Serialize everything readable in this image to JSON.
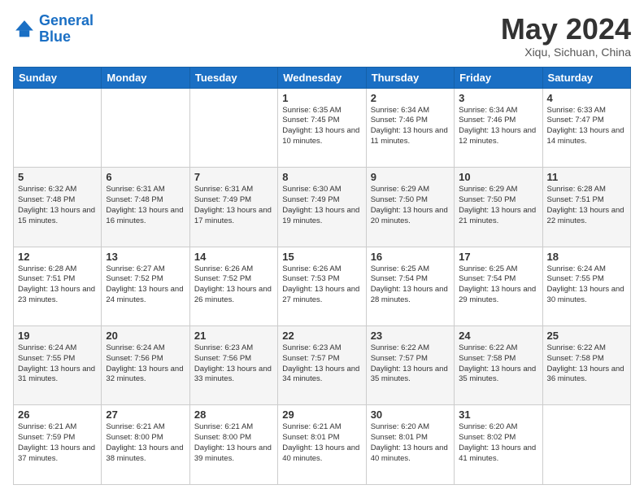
{
  "header": {
    "logo_line1": "General",
    "logo_line2": "Blue",
    "month_title": "May 2024",
    "location": "Xiqu, Sichuan, China"
  },
  "weekdays": [
    "Sunday",
    "Monday",
    "Tuesday",
    "Wednesday",
    "Thursday",
    "Friday",
    "Saturday"
  ],
  "weeks": [
    [
      {
        "day": "",
        "info": ""
      },
      {
        "day": "",
        "info": ""
      },
      {
        "day": "",
        "info": ""
      },
      {
        "day": "1",
        "info": "Sunrise: 6:35 AM\nSunset: 7:45 PM\nDaylight: 13 hours\nand 10 minutes."
      },
      {
        "day": "2",
        "info": "Sunrise: 6:34 AM\nSunset: 7:46 PM\nDaylight: 13 hours\nand 11 minutes."
      },
      {
        "day": "3",
        "info": "Sunrise: 6:34 AM\nSunset: 7:46 PM\nDaylight: 13 hours\nand 12 minutes."
      },
      {
        "day": "4",
        "info": "Sunrise: 6:33 AM\nSunset: 7:47 PM\nDaylight: 13 hours\nand 14 minutes."
      }
    ],
    [
      {
        "day": "5",
        "info": "Sunrise: 6:32 AM\nSunset: 7:48 PM\nDaylight: 13 hours\nand 15 minutes."
      },
      {
        "day": "6",
        "info": "Sunrise: 6:31 AM\nSunset: 7:48 PM\nDaylight: 13 hours\nand 16 minutes."
      },
      {
        "day": "7",
        "info": "Sunrise: 6:31 AM\nSunset: 7:49 PM\nDaylight: 13 hours\nand 17 minutes."
      },
      {
        "day": "8",
        "info": "Sunrise: 6:30 AM\nSunset: 7:49 PM\nDaylight: 13 hours\nand 19 minutes."
      },
      {
        "day": "9",
        "info": "Sunrise: 6:29 AM\nSunset: 7:50 PM\nDaylight: 13 hours\nand 20 minutes."
      },
      {
        "day": "10",
        "info": "Sunrise: 6:29 AM\nSunset: 7:50 PM\nDaylight: 13 hours\nand 21 minutes."
      },
      {
        "day": "11",
        "info": "Sunrise: 6:28 AM\nSunset: 7:51 PM\nDaylight: 13 hours\nand 22 minutes."
      }
    ],
    [
      {
        "day": "12",
        "info": "Sunrise: 6:28 AM\nSunset: 7:51 PM\nDaylight: 13 hours\nand 23 minutes."
      },
      {
        "day": "13",
        "info": "Sunrise: 6:27 AM\nSunset: 7:52 PM\nDaylight: 13 hours\nand 24 minutes."
      },
      {
        "day": "14",
        "info": "Sunrise: 6:26 AM\nSunset: 7:52 PM\nDaylight: 13 hours\nand 26 minutes."
      },
      {
        "day": "15",
        "info": "Sunrise: 6:26 AM\nSunset: 7:53 PM\nDaylight: 13 hours\nand 27 minutes."
      },
      {
        "day": "16",
        "info": "Sunrise: 6:25 AM\nSunset: 7:54 PM\nDaylight: 13 hours\nand 28 minutes."
      },
      {
        "day": "17",
        "info": "Sunrise: 6:25 AM\nSunset: 7:54 PM\nDaylight: 13 hours\nand 29 minutes."
      },
      {
        "day": "18",
        "info": "Sunrise: 6:24 AM\nSunset: 7:55 PM\nDaylight: 13 hours\nand 30 minutes."
      }
    ],
    [
      {
        "day": "19",
        "info": "Sunrise: 6:24 AM\nSunset: 7:55 PM\nDaylight: 13 hours\nand 31 minutes."
      },
      {
        "day": "20",
        "info": "Sunrise: 6:24 AM\nSunset: 7:56 PM\nDaylight: 13 hours\nand 32 minutes."
      },
      {
        "day": "21",
        "info": "Sunrise: 6:23 AM\nSunset: 7:56 PM\nDaylight: 13 hours\nand 33 minutes."
      },
      {
        "day": "22",
        "info": "Sunrise: 6:23 AM\nSunset: 7:57 PM\nDaylight: 13 hours\nand 34 minutes."
      },
      {
        "day": "23",
        "info": "Sunrise: 6:22 AM\nSunset: 7:57 PM\nDaylight: 13 hours\nand 35 minutes."
      },
      {
        "day": "24",
        "info": "Sunrise: 6:22 AM\nSunset: 7:58 PM\nDaylight: 13 hours\nand 35 minutes."
      },
      {
        "day": "25",
        "info": "Sunrise: 6:22 AM\nSunset: 7:58 PM\nDaylight: 13 hours\nand 36 minutes."
      }
    ],
    [
      {
        "day": "26",
        "info": "Sunrise: 6:21 AM\nSunset: 7:59 PM\nDaylight: 13 hours\nand 37 minutes."
      },
      {
        "day": "27",
        "info": "Sunrise: 6:21 AM\nSunset: 8:00 PM\nDaylight: 13 hours\nand 38 minutes."
      },
      {
        "day": "28",
        "info": "Sunrise: 6:21 AM\nSunset: 8:00 PM\nDaylight: 13 hours\nand 39 minutes."
      },
      {
        "day": "29",
        "info": "Sunrise: 6:21 AM\nSunset: 8:01 PM\nDaylight: 13 hours\nand 40 minutes."
      },
      {
        "day": "30",
        "info": "Sunrise: 6:20 AM\nSunset: 8:01 PM\nDaylight: 13 hours\nand 40 minutes."
      },
      {
        "day": "31",
        "info": "Sunrise: 6:20 AM\nSunset: 8:02 PM\nDaylight: 13 hours\nand 41 minutes."
      },
      {
        "day": "",
        "info": ""
      }
    ]
  ]
}
